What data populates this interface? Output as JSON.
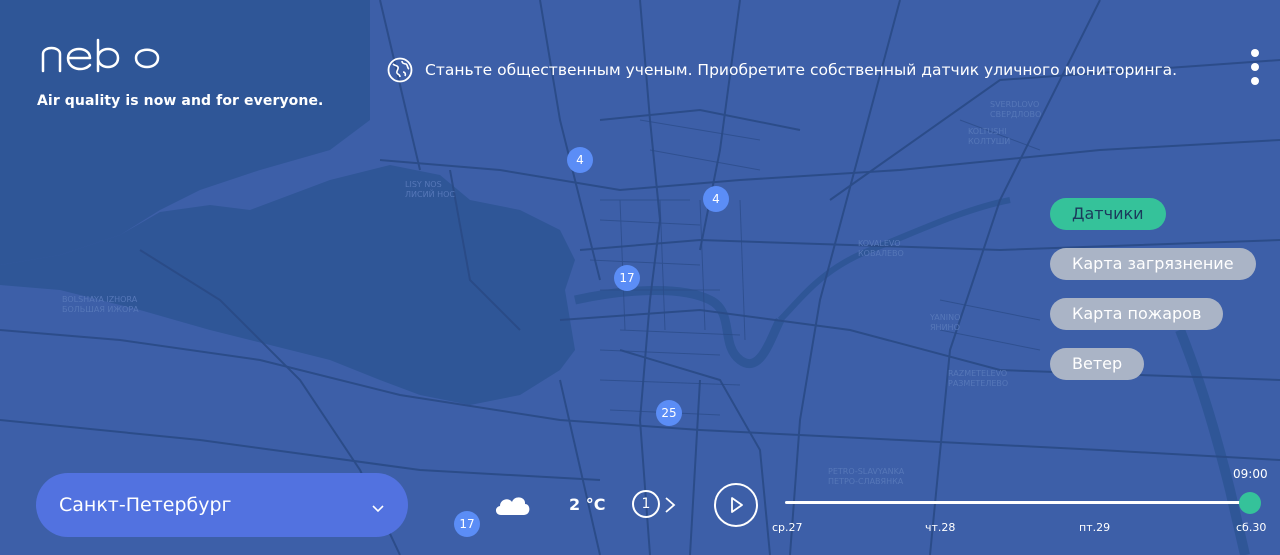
{
  "brand": {
    "logo_text": "nebo",
    "tagline": "Air quality is now and for everyone."
  },
  "banner": {
    "icon": "globe-icon",
    "text": "Станьте общественным ученым. Приобретите собственный датчик уличного мониторинга."
  },
  "menu": {
    "icon": "kebab-menu-icon"
  },
  "layers": [
    {
      "label": "Датчики",
      "active": true
    },
    {
      "label": "Карта загрязнение",
      "active": false
    },
    {
      "label": "Карта пожаров",
      "active": false
    },
    {
      "label": "Ветер",
      "active": false
    }
  ],
  "map": {
    "markers": [
      "4",
      "4",
      "17",
      "25",
      "17"
    ],
    "place_labels": [
      "LISY NOS",
      "ЛИСИЙ НОС",
      "BOLSHAYA IZHORA",
      "БОЛЬШАЯ ИЖОРА",
      "KOLTUSHI",
      "КОЛТУШИ",
      "SVERDLOVO",
      "СВЕРДЛОВО",
      "KOVALEVO",
      "КОВАЛЕВО",
      "YANINO",
      "ЯНИНО",
      "RAZMETELEVO",
      "РАЗМЕТЕЛЕВО",
      "PETRO-SLAVYANKA",
      "ПЕТРО-СЛАВЯНКА"
    ],
    "colors": {
      "water": "#2f5697",
      "land": "#3d5fa8",
      "road": "#2a4a86"
    }
  },
  "city": {
    "name": "Санкт-Петербург",
    "icon": "chevron-down-icon"
  },
  "weather": {
    "icon": "cloud-icon",
    "temperature": "2 °C"
  },
  "playback": {
    "step": "1",
    "next_icon": "chevron-right-icon",
    "play_icon": "play-icon",
    "current_time": "09:00",
    "position": 1.0,
    "days": [
      "ср.27",
      "чт.28",
      "пт.29",
      "сб.30"
    ]
  },
  "accent_colors": {
    "active": "#35c29a",
    "inactive": "#aab4c6",
    "marker": "#5b8df6",
    "city_select": "#5272e0"
  }
}
